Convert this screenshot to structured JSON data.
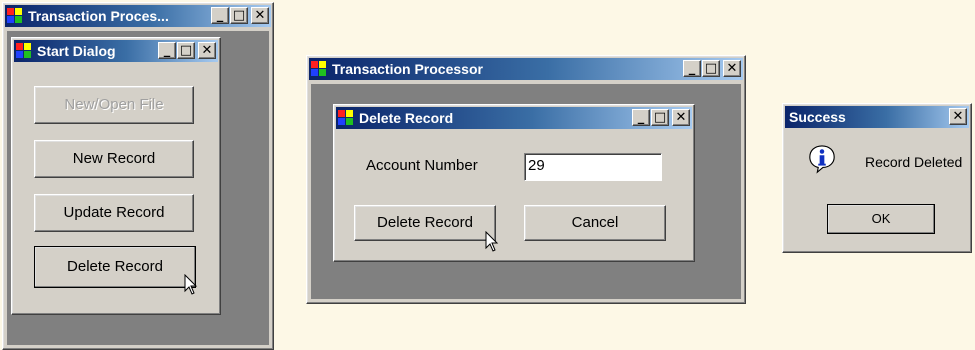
{
  "left_window": {
    "title": "Transaction Proces...",
    "title_buttons": [
      "_",
      "□",
      "✕"
    ],
    "child": {
      "title": "Start Dialog",
      "buttons": [
        {
          "label": "New/Open File",
          "disabled": true
        },
        {
          "label": "New Record",
          "disabled": false
        },
        {
          "label": "Update Record",
          "disabled": false
        },
        {
          "label": "Delete Record",
          "disabled": false
        }
      ]
    }
  },
  "middle_window": {
    "title": "Transaction Processor",
    "child": {
      "title": "Delete Record",
      "account_label": "Account Number",
      "account_value": "29",
      "delete_button": "Delete Record",
      "cancel_button": "Cancel"
    }
  },
  "message_box": {
    "title": "Success",
    "message": "Record Deleted",
    "ok_button": "OK",
    "icon": "info-icon"
  },
  "colors": {
    "desktop": "#fdf8e6",
    "titlebar_start": "#0a246a",
    "titlebar_end": "#a6caf0",
    "mdi_background": "#808080",
    "face": "#d4d0c8"
  }
}
